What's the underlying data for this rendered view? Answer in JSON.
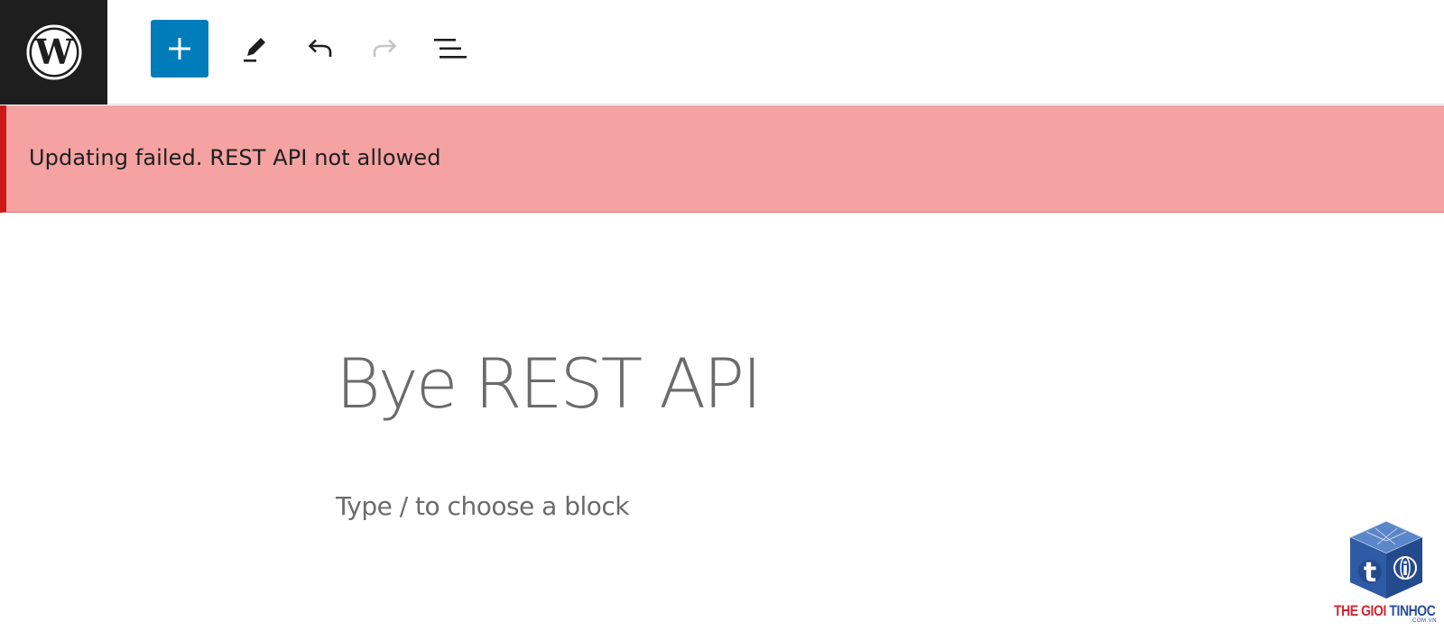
{
  "toolbar": {
    "logo": "wordpress-logo",
    "add_icon": "plus-icon",
    "edit_icon": "pencil-icon",
    "undo_icon": "undo-icon",
    "redo_icon": "redo-icon",
    "list_icon": "document-overview-icon",
    "colors": {
      "logo_bg": "#1e1e1e",
      "add_bg": "#007cba",
      "redo_disabled": "#c3c4c7"
    }
  },
  "notice": {
    "message": "Updating failed. REST API not allowed",
    "colors": {
      "background": "#f4a2a2",
      "border": "#cc1818"
    }
  },
  "editor": {
    "title": "Bye REST API",
    "block_placeholder": "Type / to choose a block"
  },
  "watermark": {
    "part1": "THE GIOI",
    "part2": "TINHOC",
    "domain": ".COM.VN",
    "colors": {
      "red": "#d22630",
      "blue": "#2b4d9a"
    }
  }
}
